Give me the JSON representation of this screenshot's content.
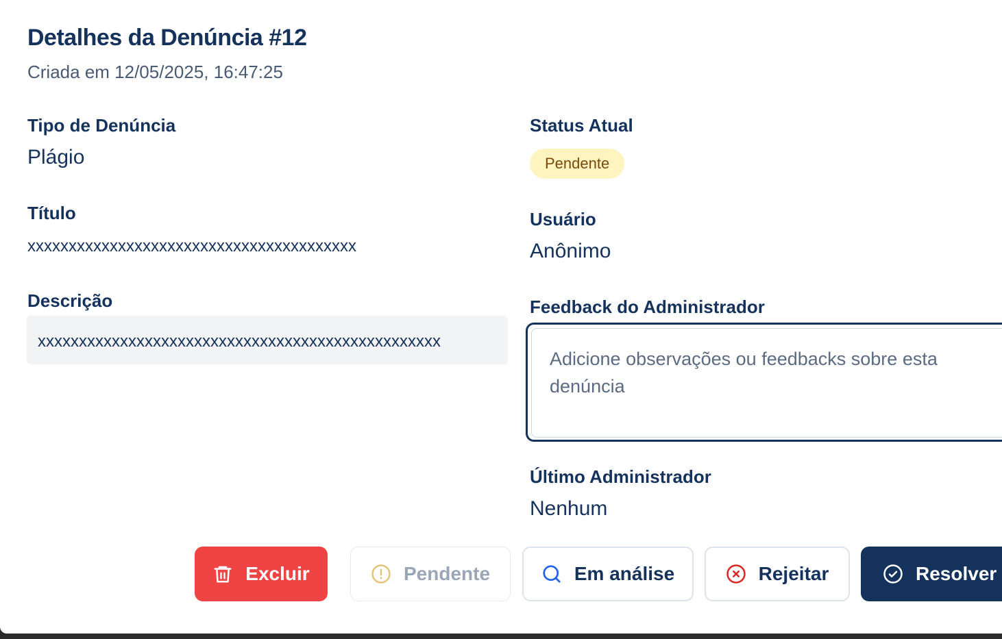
{
  "header": {
    "title": "Detalhes da Denúncia #12",
    "created": "Criada em 12/05/2025, 16:47:25"
  },
  "fields": {
    "type_label": "Tipo de Denúncia",
    "type_value": "Plágio",
    "title_label": "Título",
    "title_value": "xxxxxxxxxxxxxxxxxxxxxxxxxxxxxxxxxxxxxxxx",
    "desc_label": "Descrição",
    "desc_value": "xxxxxxxxxxxxxxxxxxxxxxxxxxxxxxxxxxxxxxxxxxxxxxxxx",
    "status_label": "Status Atual",
    "status_value": "Pendente",
    "user_label": "Usuário",
    "user_value": "Anônimo",
    "feedback_label": "Feedback do Administrador",
    "feedback_placeholder": "Adicione observações ou feedbacks sobre esta denúncia",
    "feedback_value": "",
    "last_admin_label": "Último Administrador",
    "last_admin_value": "Nenhum"
  },
  "actions": {
    "delete": "Excluir",
    "pending": "Pendente",
    "analysis": "Em análise",
    "reject": "Rejeitar",
    "resolve": "Resolver"
  },
  "colors": {
    "primary": "#14325c",
    "danger": "#ef4444",
    "badge_bg": "#fdf4bf",
    "badge_text": "#7a4a0b"
  },
  "icons": {
    "delete": "trash-icon",
    "pending": "alert-circle-icon",
    "analysis": "search-icon",
    "reject": "x-circle-icon",
    "resolve": "check-circle-icon"
  }
}
